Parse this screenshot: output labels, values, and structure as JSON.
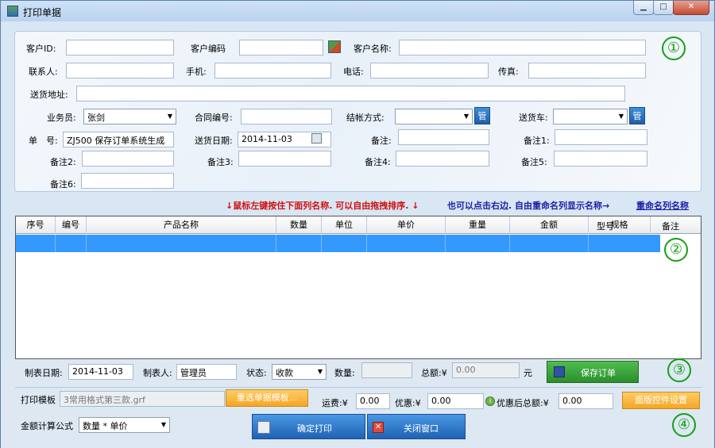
{
  "window": {
    "title": "打印单据",
    "min_glyph": "▁",
    "max_glyph": "□",
    "close_glyph": "✕"
  },
  "markers": [
    "①",
    "②",
    "③",
    "④"
  ],
  "header_form": {
    "customer_id_label": "客户ID:",
    "customer_id_value": "",
    "customer_code_label": "客户编码",
    "customer_code_value": "",
    "customer_name_label": "客户名称:",
    "customer_name_value": "",
    "contact_label": "联系人:",
    "contact_value": "",
    "mobile_label": "手机:",
    "mobile_value": "",
    "phone_label": "电话:",
    "phone_value": "",
    "fax_label": "传真:",
    "fax_value": "",
    "address_label": "送货地址:",
    "address_value": "",
    "salesman_label": "业务员:",
    "salesman_value": "张剑",
    "contract_label": "合同编号:",
    "contract_value": "",
    "settle_label": "结帐方式:",
    "settle_value": "",
    "manage_label": "管",
    "vehicle_label": "送货车:",
    "vehicle_value": "",
    "order_no_label": "单　号:",
    "order_no_value": "ZJ500 保存订单系统生成",
    "delivery_date_label": "送货日期:",
    "delivery_date_value": "2014-11-03",
    "note_label": "备注:",
    "note_value": "",
    "note1_label": "备注1:",
    "note1_value": "",
    "note2_label": "备注2:",
    "note2_value": "",
    "note3_label": "备注3:",
    "note3_value": "",
    "note4_label": "备注4:",
    "note4_value": "",
    "note5_label": "备注5:",
    "note5_value": "",
    "note6_label": "备注6:",
    "note6_value": ""
  },
  "hints": {
    "red": "↓鼠标左键按住下面列名称. 可以自由拖拽排序. ↓",
    "blue": "也可以点击右边. 自由重命名列显示名称→",
    "link": "重命名列名称"
  },
  "grid": {
    "columns": [
      "序号",
      "编号",
      "产品名称",
      "数量",
      "单位",
      "单价",
      "重量",
      "金额",
      "规格",
      "型号",
      "备注"
    ]
  },
  "footer": {
    "made_date_label": "制表日期:",
    "made_date_value": "2014-11-03",
    "maker_label": "制表人:",
    "maker_value": "管理员",
    "status_label": "状态:",
    "status_value": "收款",
    "qty_label": "数量:",
    "qty_value": "",
    "total_label": "总额:¥",
    "total_value": "0.00",
    "total_unit": "元",
    "save_button": "保存订单",
    "template_label": "打印模板",
    "template_value": "3常用格式第三款.grf",
    "reselect_button": "重选单据模板...",
    "freight_label": "运费:¥",
    "freight_value": "0.00",
    "discount_label": "优惠:¥",
    "discount_value": "0.00",
    "after_discount_label": "优惠后总额:¥",
    "after_discount_value": "0.00",
    "panel_settings_button": "面版控件设置",
    "formula_label": "金额计算公式",
    "formula_value": "数量 * 单价",
    "print_button": "确定打印",
    "close_button": "关闭窗口"
  }
}
